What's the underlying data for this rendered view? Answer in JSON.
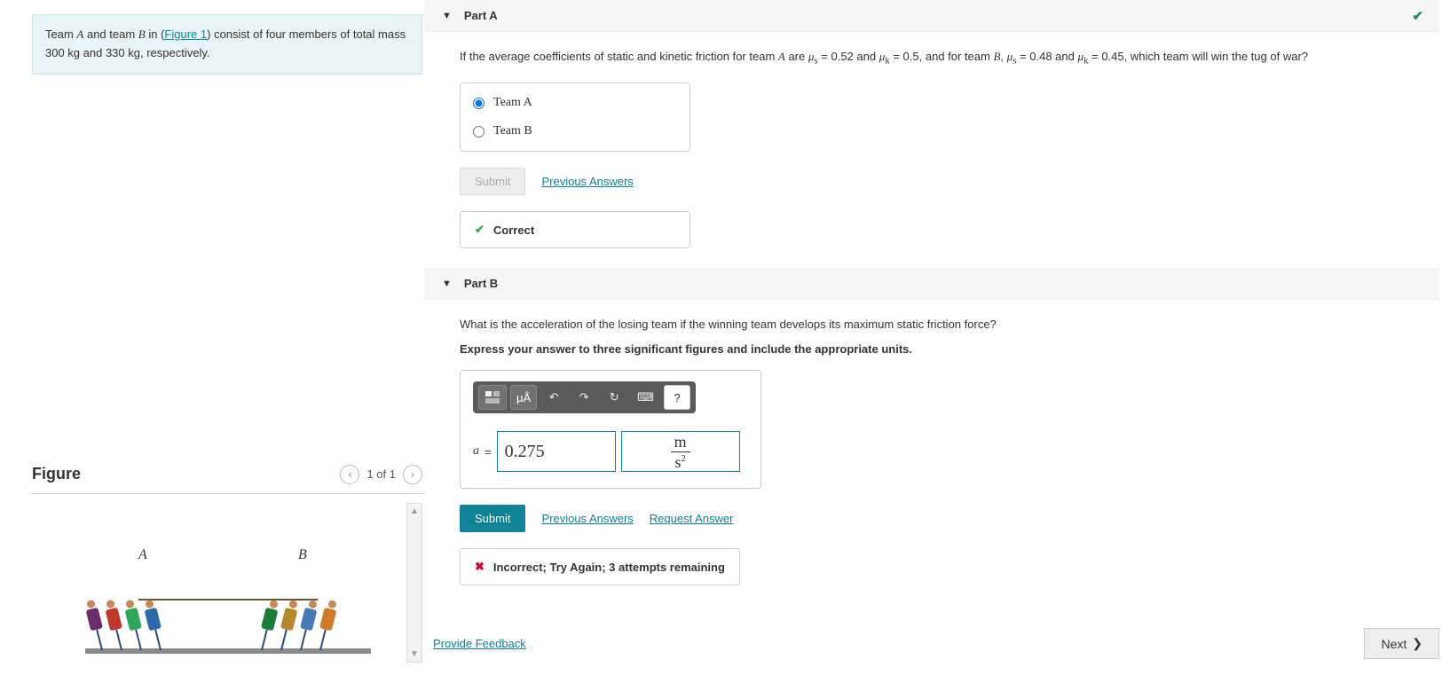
{
  "problem": {
    "prefix": "Team ",
    "teamA": "A",
    "mid1": " and team ",
    "teamB": "B",
    "mid2": " in (",
    "figLink": "Figure 1",
    "mid3": ") consist of four members of total mass 300 kg and 330 kg, respectively."
  },
  "figure": {
    "title": "Figure",
    "pager": "1 of 1",
    "labelA": "A",
    "labelB": "B"
  },
  "partA": {
    "title": "Part A",
    "question": "If the average coefficients of static and kinetic friction for team A are μₛ = 0.52 and μₖ = 0.5, and for team B, μₛ = 0.48 and μₖ = 0.45, which team will win the tug of war?",
    "optA": "Team A",
    "optB": "Team B",
    "submit": "Submit",
    "prev": "Previous Answers",
    "correct": "Correct"
  },
  "partB": {
    "title": "Part B",
    "q1": "What is the acceleration of the losing team if the winning team develops its maximum static friction force?",
    "q2": "Express your answer to three significant figures and include the appropriate units.",
    "var": "a",
    "equals": " = ",
    "value": "0.275",
    "unit_num": "m",
    "unit_den_base": "s",
    "unit_den_exp": "2",
    "submit": "Submit",
    "prev": "Previous Answers",
    "req": "Request Answer",
    "feedback": "Incorrect; Try Again; 3 attempts remaining",
    "toolbar": {
      "tex": "μÅ",
      "help": "?"
    }
  },
  "footer": {
    "feedbackLink": "Provide Feedback",
    "next": "Next"
  }
}
